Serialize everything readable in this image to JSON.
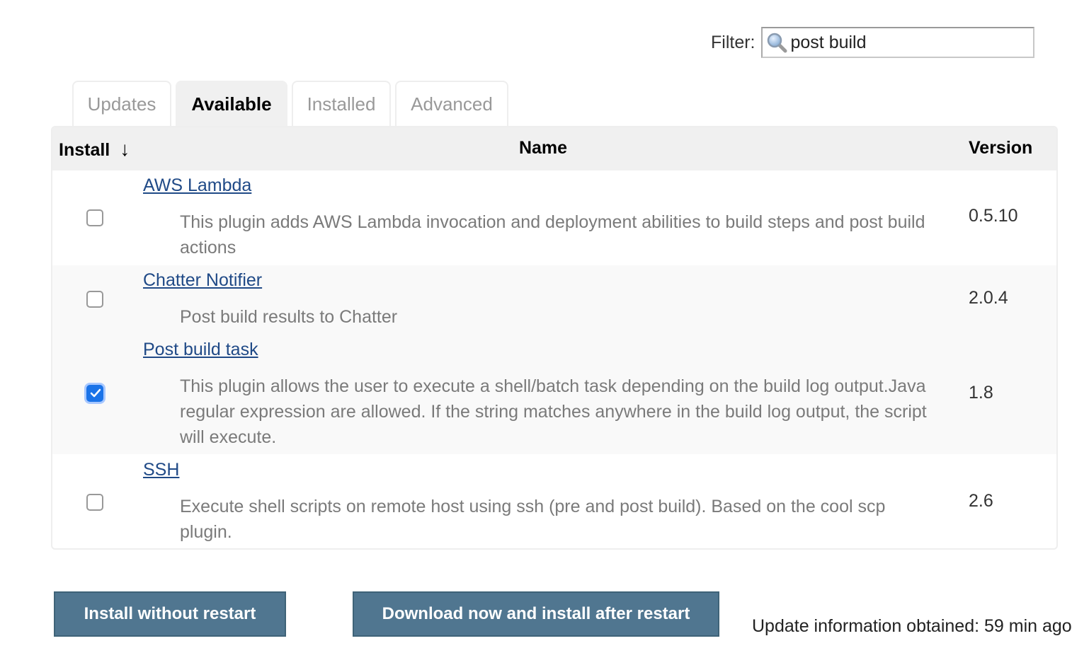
{
  "filter": {
    "label": "Filter:",
    "value": "post build",
    "icon": "magnifier-icon"
  },
  "tabs": [
    {
      "label": "Updates",
      "active": false
    },
    {
      "label": "Available",
      "active": true
    },
    {
      "label": "Installed",
      "active": false
    },
    {
      "label": "Advanced",
      "active": false
    }
  ],
  "table": {
    "headers": {
      "install": "Install",
      "sort_arrow": "↓",
      "name": "Name",
      "version": "Version"
    },
    "rows": [
      {
        "name": "AWS Lambda",
        "description_lines": [
          "This plugin adds AWS Lambda invocation and deployment abilities to build steps and post build",
          "actions"
        ],
        "version": "0.5.10",
        "checked": false
      },
      {
        "name": "Chatter Notifier",
        "description_lines": [
          "Post build results to Chatter"
        ],
        "version": "2.0.4",
        "checked": false
      },
      {
        "name": "Post build task",
        "description_lines": [
          "This plugin allows the user to execute a shell/batch task depending on the build log output.Java",
          "regular expression are allowed. If the string matches anywhere in the build log output, the script",
          "will execute."
        ],
        "version": "1.8",
        "checked": true
      },
      {
        "name": "SSH",
        "description_lines": [
          "Execute shell scripts on remote host using ssh (pre and post build). Based on the cool scp",
          "plugin."
        ],
        "version": "2.6",
        "checked": false
      }
    ]
  },
  "buttons": {
    "install_without_restart": "Install without restart",
    "download_and_install_after_restart": "Download now and install after restart"
  },
  "update_info": "Update information obtained: 59 min ago",
  "colors": {
    "button_bg": "#507690",
    "link": "#204a87",
    "checkbox_checked": "#1a73e8"
  }
}
